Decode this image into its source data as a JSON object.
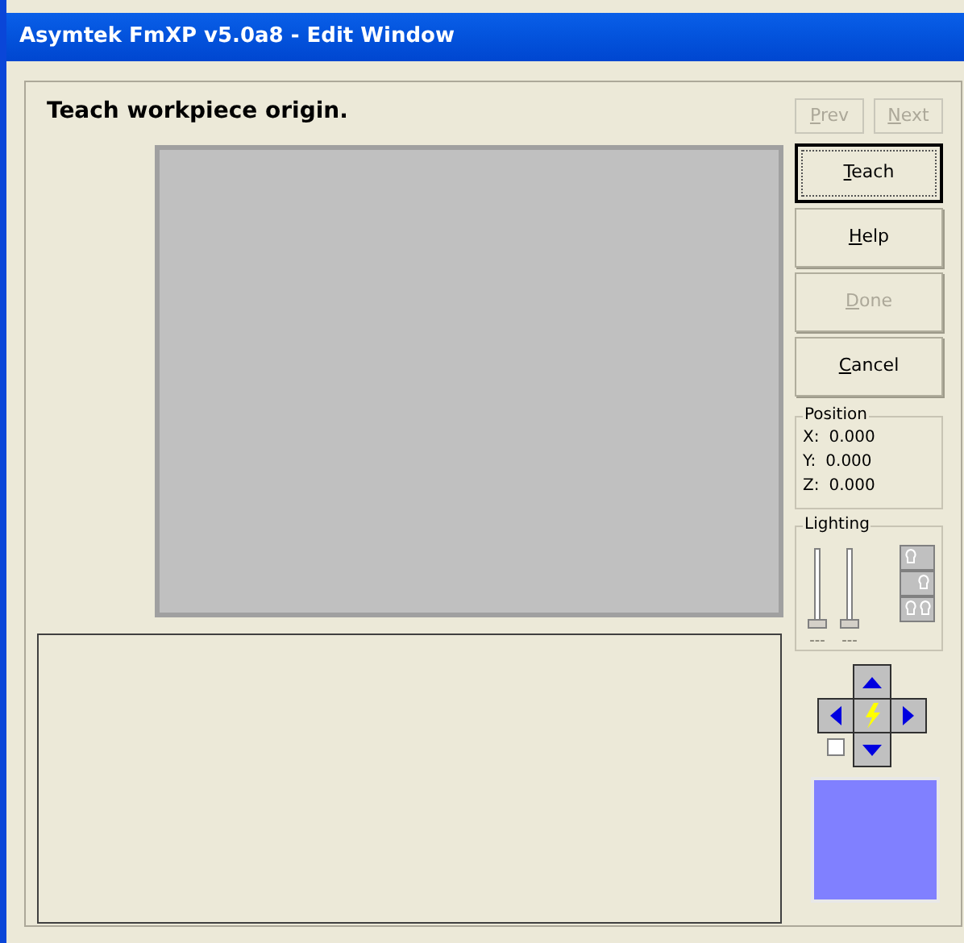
{
  "window": {
    "title": "Asymtek FmXP v5.0a8 - Edit Window"
  },
  "instruction": "Teach workpiece origin.",
  "nav_buttons": [
    {
      "label": "Prev",
      "disabled": true
    },
    {
      "label": "Next",
      "disabled": true
    }
  ],
  "buttons": [
    {
      "label": "Teach",
      "disabled": false,
      "focused": true
    },
    {
      "label": "Help",
      "disabled": false,
      "focused": false
    },
    {
      "label": "Done",
      "disabled": true,
      "focused": false
    },
    {
      "label": "Cancel",
      "disabled": false,
      "focused": false
    }
  ],
  "position": {
    "title": "Position",
    "rows": [
      {
        "axis": "X:",
        "value": "0.000"
      },
      {
        "axis": "Y:",
        "value": "0.000"
      },
      {
        "axis": "Z:",
        "value": "0.000"
      }
    ]
  },
  "lighting": {
    "title": "Lighting",
    "sliders": [
      {
        "level": 0,
        "reading": "---"
      },
      {
        "level": 0,
        "reading": "---"
      }
    ]
  },
  "jog": {
    "checkbox": {
      "checked": false
    }
  }
}
